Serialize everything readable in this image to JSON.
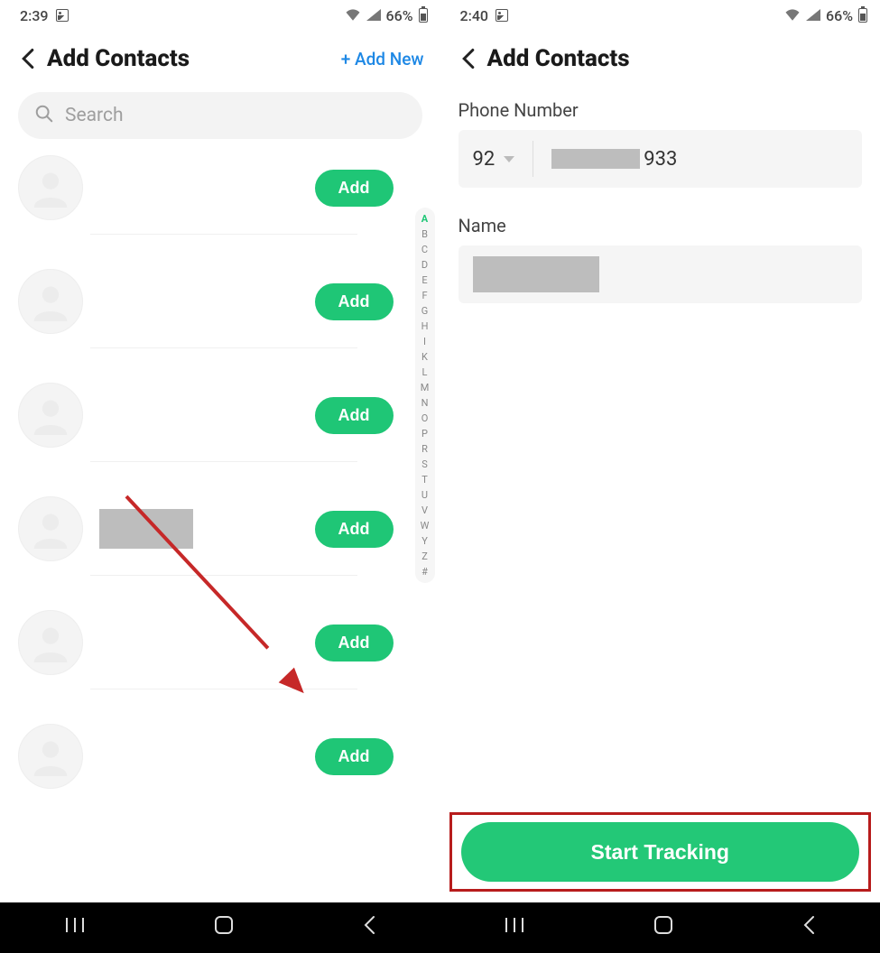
{
  "left": {
    "status": {
      "time": "2:39",
      "battery": "66%"
    },
    "header": {
      "title": "Add Contacts",
      "add_new": "+ Add New"
    },
    "search": {
      "placeholder": "Search"
    },
    "add_label": "Add",
    "index_letters": [
      "A",
      "B",
      "C",
      "D",
      "E",
      "F",
      "G",
      "H",
      "I",
      "K",
      "L",
      "M",
      "N",
      "O",
      "P",
      "R",
      "S",
      "T",
      "U",
      "V",
      "W",
      "Y",
      "Z",
      "#"
    ]
  },
  "right": {
    "status": {
      "time": "2:40",
      "battery": "66%"
    },
    "header": {
      "title": "Add Contacts"
    },
    "phone_label": "Phone Number",
    "country_code": "92",
    "phone_suffix": "933",
    "name_label": "Name",
    "start_tracking": "Start Tracking"
  },
  "nav": {
    "recents": "|||",
    "home": "◯",
    "back": "‹"
  }
}
